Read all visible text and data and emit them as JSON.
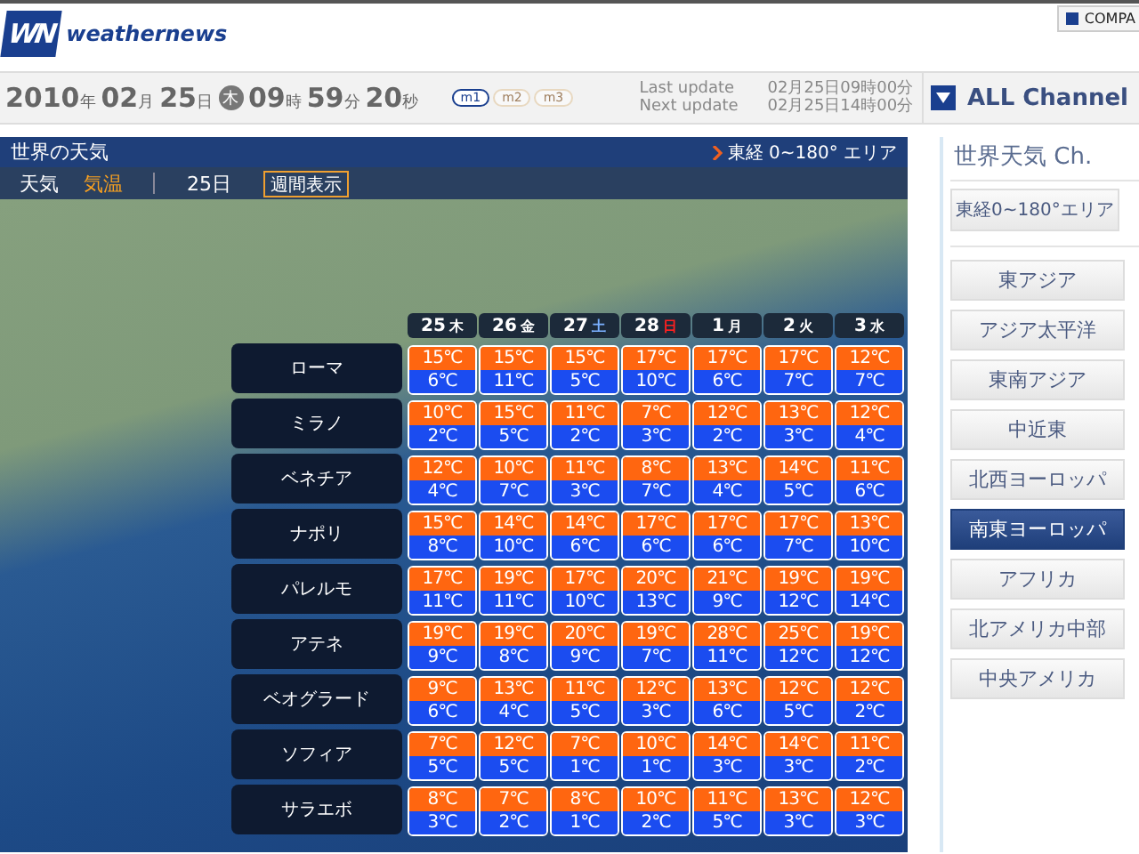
{
  "header": {
    "logo_mark": "WN",
    "logo_text": "weathernews",
    "corner_button": "COMPA"
  },
  "datebar": {
    "parts": [
      {
        "value": "2010",
        "unit": "年"
      },
      {
        "value": "02",
        "unit": "月"
      },
      {
        "value": "25",
        "unit": "日"
      }
    ],
    "weekday": "木",
    "time_parts": [
      {
        "value": "09",
        "unit": "時"
      },
      {
        "value": "59",
        "unit": "分"
      },
      {
        "value": "20",
        "unit": "秒"
      }
    ],
    "modes": [
      {
        "label": "m1",
        "selected": true
      },
      {
        "label": "m2",
        "selected": false
      },
      {
        "label": "m3",
        "selected": false
      }
    ],
    "updates": [
      {
        "label": "Last update",
        "value": "02月25日09時00分"
      },
      {
        "label": "Next update",
        "value": "02月25日14時00分"
      }
    ],
    "channel_button": "ALL Channel"
  },
  "panel": {
    "title": "世界の天気",
    "area_link": "東経 0~180° エリア",
    "tabs": [
      {
        "label": "天気",
        "selected": false
      },
      {
        "label": "気温",
        "selected": true
      }
    ],
    "day_label": "25日",
    "week_button": "週間表示",
    "days": [
      {
        "date": "25",
        "weekday": "木",
        "kind": "weekday"
      },
      {
        "date": "26",
        "weekday": "金",
        "kind": "weekday"
      },
      {
        "date": "27",
        "weekday": "土",
        "kind": "saturday"
      },
      {
        "date": "28",
        "weekday": "日",
        "kind": "sunday"
      },
      {
        "date": "1",
        "weekday": "月",
        "kind": "weekday"
      },
      {
        "date": "2",
        "weekday": "火",
        "kind": "weekday"
      },
      {
        "date": "3",
        "weekday": "水",
        "kind": "weekday"
      }
    ],
    "cities": [
      {
        "name": "ローマ",
        "temps": [
          [
            "15℃",
            "6℃"
          ],
          [
            "15℃",
            "11℃"
          ],
          [
            "15℃",
            "5℃"
          ],
          [
            "17℃",
            "10℃"
          ],
          [
            "17℃",
            "6℃"
          ],
          [
            "17℃",
            "7℃"
          ],
          [
            "12℃",
            "7℃"
          ]
        ]
      },
      {
        "name": "ミラノ",
        "temps": [
          [
            "10℃",
            "2℃"
          ],
          [
            "15℃",
            "5℃"
          ],
          [
            "11℃",
            "2℃"
          ],
          [
            "7℃",
            "3℃"
          ],
          [
            "12℃",
            "2℃"
          ],
          [
            "13℃",
            "3℃"
          ],
          [
            "12℃",
            "4℃"
          ]
        ]
      },
      {
        "name": "ベネチア",
        "temps": [
          [
            "12℃",
            "4℃"
          ],
          [
            "10℃",
            "7℃"
          ],
          [
            "11℃",
            "3℃"
          ],
          [
            "8℃",
            "7℃"
          ],
          [
            "13℃",
            "4℃"
          ],
          [
            "14℃",
            "5℃"
          ],
          [
            "11℃",
            "6℃"
          ]
        ]
      },
      {
        "name": "ナポリ",
        "temps": [
          [
            "15℃",
            "8℃"
          ],
          [
            "14℃",
            "10℃"
          ],
          [
            "14℃",
            "6℃"
          ],
          [
            "17℃",
            "6℃"
          ],
          [
            "17℃",
            "6℃"
          ],
          [
            "17℃",
            "7℃"
          ],
          [
            "13℃",
            "10℃"
          ]
        ]
      },
      {
        "name": "パレルモ",
        "temps": [
          [
            "17℃",
            "11℃"
          ],
          [
            "19℃",
            "11℃"
          ],
          [
            "17℃",
            "10℃"
          ],
          [
            "20℃",
            "13℃"
          ],
          [
            "21℃",
            "9℃"
          ],
          [
            "19℃",
            "12℃"
          ],
          [
            "19℃",
            "14℃"
          ]
        ]
      },
      {
        "name": "アテネ",
        "temps": [
          [
            "19℃",
            "9℃"
          ],
          [
            "19℃",
            "8℃"
          ],
          [
            "20℃",
            "9℃"
          ],
          [
            "19℃",
            "7℃"
          ],
          [
            "28℃",
            "11℃"
          ],
          [
            "25℃",
            "12℃"
          ],
          [
            "19℃",
            "12℃"
          ]
        ]
      },
      {
        "name": "ベオグラード",
        "temps": [
          [
            "9℃",
            "6℃"
          ],
          [
            "13℃",
            "4℃"
          ],
          [
            "11℃",
            "5℃"
          ],
          [
            "12℃",
            "3℃"
          ],
          [
            "13℃",
            "6℃"
          ],
          [
            "12℃",
            "5℃"
          ],
          [
            "12℃",
            "2℃"
          ]
        ]
      },
      {
        "name": "ソフィア",
        "temps": [
          [
            "7℃",
            "5℃"
          ],
          [
            "12℃",
            "5℃"
          ],
          [
            "7℃",
            "1℃"
          ],
          [
            "10℃",
            "1℃"
          ],
          [
            "14℃",
            "3℃"
          ],
          [
            "14℃",
            "3℃"
          ],
          [
            "11℃",
            "2℃"
          ]
        ]
      },
      {
        "name": "サラエボ",
        "temps": [
          [
            "8℃",
            "3℃"
          ],
          [
            "7℃",
            "2℃"
          ],
          [
            "8℃",
            "1℃"
          ],
          [
            "10℃",
            "2℃"
          ],
          [
            "11℃",
            "5℃"
          ],
          [
            "13℃",
            "3℃"
          ],
          [
            "12℃",
            "3℃"
          ]
        ]
      }
    ]
  },
  "sidebar": {
    "title": "世界天気 Ch.",
    "area_button": "東経0~180°エリア",
    "items": [
      {
        "label": "東アジア",
        "selected": false
      },
      {
        "label": "アジア太平洋",
        "selected": false
      },
      {
        "label": "東南アジア",
        "selected": false
      },
      {
        "label": "中近東",
        "selected": false
      },
      {
        "label": "北西ヨーロッパ",
        "selected": false
      },
      {
        "label": "南東ヨーロッパ",
        "selected": true
      },
      {
        "label": "アフリカ",
        "selected": false
      },
      {
        "label": "北アメリカ中部",
        "selected": false
      },
      {
        "label": "中央アメリカ",
        "selected": false
      }
    ]
  }
}
